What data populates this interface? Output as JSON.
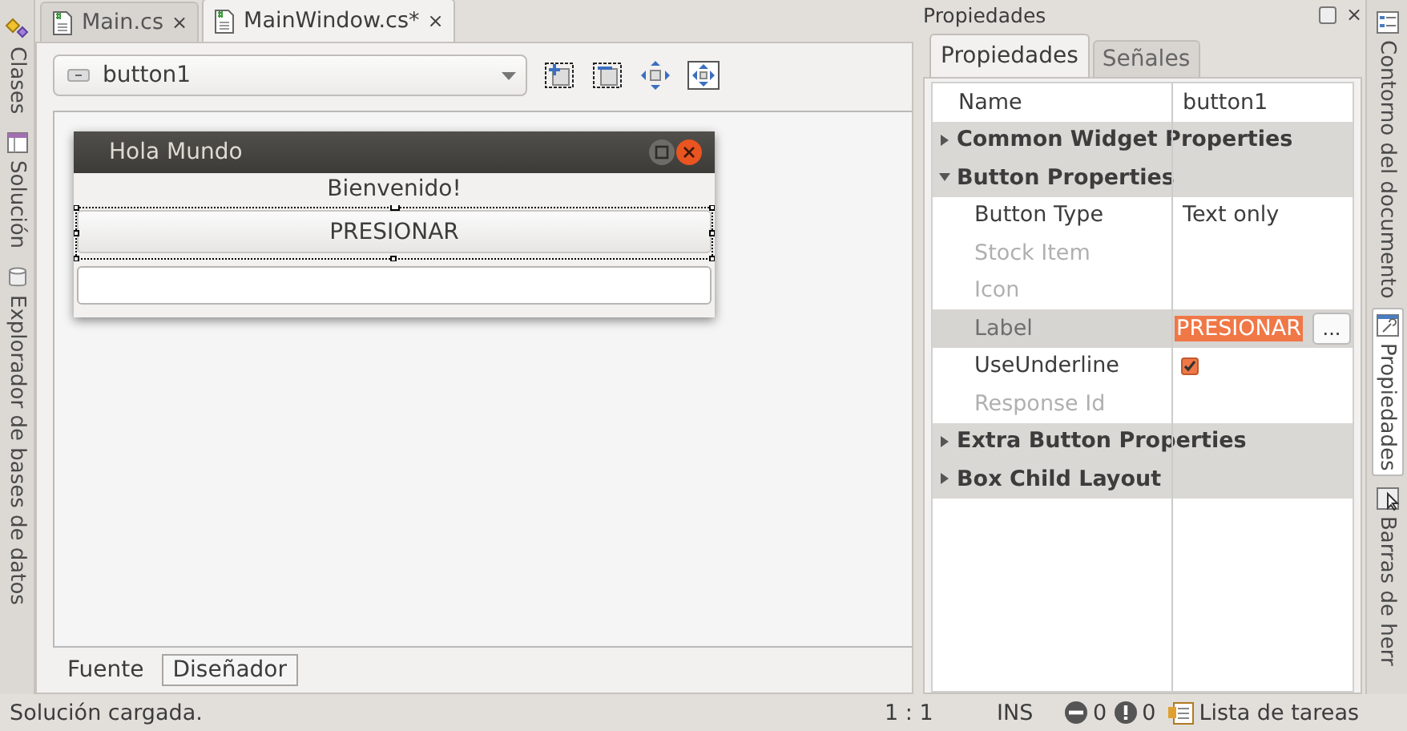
{
  "left_dock": [
    {
      "label": "Clases",
      "selected": false,
      "kind": "classes"
    },
    {
      "label": "Solución",
      "selected": false,
      "kind": "solution"
    },
    {
      "label": "Explorador de bases de datos",
      "selected": false,
      "kind": "database"
    }
  ],
  "document_tabs": [
    {
      "label": "Main.cs",
      "selected": false,
      "close": "×"
    },
    {
      "label": "MainWindow.cs*",
      "selected": true,
      "close": "×"
    }
  ],
  "designer": {
    "widget_selector": "button1",
    "preview_window": {
      "title": "Hola Mundo",
      "label": "Bienvenido!",
      "button": "PRESIONAR"
    }
  },
  "view_tabs": [
    {
      "label": "Fuente",
      "selected": false
    },
    {
      "label": "Diseñador",
      "selected": true
    }
  ],
  "properties_panel": {
    "title": "Propiedades",
    "close": "×",
    "tabs": [
      {
        "label": "Propiedades",
        "selected": true
      },
      {
        "label": "Señales",
        "selected": false
      }
    ],
    "rows": [
      {
        "kind": "prop",
        "name": "Name",
        "value": "button1",
        "disabled": false,
        "selected": false
      },
      {
        "kind": "group",
        "name": "Common Widget Properties",
        "expanded": false
      },
      {
        "kind": "group",
        "name": "Button Properties",
        "expanded": true,
        "children": [
          {
            "kind": "prop",
            "name": "Button Type",
            "value": "Text only",
            "disabled": false,
            "selected": false
          },
          {
            "kind": "prop",
            "name": "Stock Item",
            "disabled": true,
            "selected": false
          },
          {
            "kind": "prop",
            "name": "Icon",
            "disabled": true,
            "selected": false
          },
          {
            "kind": "prop",
            "name": "Label",
            "value": "PRESIONAR",
            "disabled": true,
            "selected": true,
            "edit_button": "..."
          },
          {
            "kind": "check",
            "name": "UseUnderline",
            "checked": true,
            "disabled": false,
            "selected": false
          },
          {
            "kind": "prop",
            "name": "Response Id",
            "disabled": true,
            "selected": false
          }
        ]
      },
      {
        "kind": "group",
        "name": "Extra Button Properties",
        "expanded": false
      },
      {
        "kind": "group",
        "name": "Box Child Layout",
        "expanded": false
      }
    ]
  },
  "right_dock": [
    {
      "label": "Contorno del documento",
      "selected": false,
      "kind": "outline"
    },
    {
      "label": "Propiedades",
      "selected": true,
      "kind": "properties"
    },
    {
      "label": "Barras de herr",
      "selected": false,
      "kind": "toolbars"
    }
  ],
  "status_bar": {
    "message": "Solución cargada.",
    "position": "1 : 1",
    "mode": "INS",
    "errors": "0",
    "warnings": "0",
    "task_list": "Lista de tareas"
  }
}
